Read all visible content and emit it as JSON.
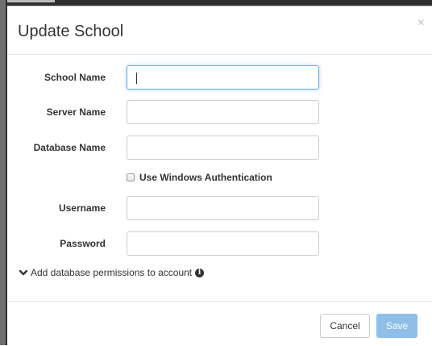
{
  "modal": {
    "title": "Update School",
    "close_label": "×"
  },
  "form": {
    "school_name": {
      "label": "School Name",
      "value": ""
    },
    "server_name": {
      "label": "Server Name",
      "value": ""
    },
    "database_name": {
      "label": "Database Name",
      "value": ""
    },
    "windows_auth": {
      "label": "Use Windows Authentication",
      "checked": false
    },
    "username": {
      "label": "Username",
      "value": ""
    },
    "password": {
      "label": "Password",
      "value": ""
    },
    "permissions_toggle": {
      "label": "Add database permissions to account",
      "icon": "chevron-down-icon",
      "info_icon": "info-icon"
    }
  },
  "footer": {
    "cancel_label": "Cancel",
    "save_label": "Save"
  },
  "colors": {
    "focus_border": "#66afe9",
    "save_button": "#8fbfe8",
    "input_border": "#cccccc"
  }
}
